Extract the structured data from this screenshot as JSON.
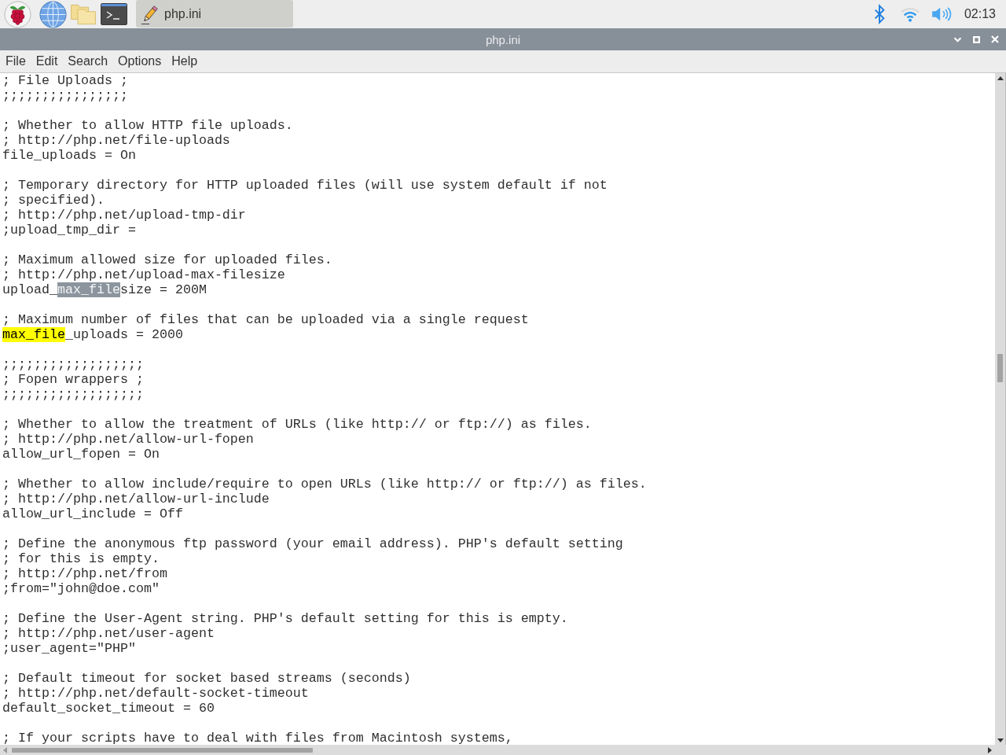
{
  "taskbar": {
    "tasks": [
      {
        "label": "php.ini",
        "selected": true
      }
    ],
    "clock": "02:13"
  },
  "window": {
    "title": "php.ini"
  },
  "menu": [
    "File",
    "Edit",
    "Search",
    "Options",
    "Help"
  ],
  "editor": {
    "blocks": [
      {
        "lines": [
          {
            "text": "; File Uploads ;"
          },
          {
            "text": ";;;;;;;;;;;;;;;;"
          }
        ]
      },
      {
        "lines": [
          {
            "text": "; Whether to allow HTTP file uploads."
          },
          {
            "text": "; http://php.net/file-uploads"
          },
          {
            "text": "file_uploads = On"
          }
        ]
      },
      {
        "lines": [
          {
            "text": "; Temporary directory for HTTP uploaded files (will use system default if not"
          },
          {
            "text": "; specified)."
          },
          {
            "text": "; http://php.net/upload-tmp-dir"
          },
          {
            "text": ";upload_tmp_dir ="
          }
        ]
      },
      {
        "lines": [
          {
            "text": "; Maximum allowed size for uploaded files."
          },
          {
            "text": "; http://php.net/upload-max-filesize"
          },
          {
            "parts": [
              {
                "text": "upload_",
                "kind": "plain"
              },
              {
                "text": "max_file",
                "kind": "selection"
              },
              {
                "text": "size = 200M",
                "kind": "plain"
              }
            ]
          }
        ]
      },
      {
        "lines": [
          {
            "text": "; Maximum number of files that can be uploaded via a single request"
          },
          {
            "parts": [
              {
                "text": "max_file",
                "kind": "match"
              },
              {
                "text": "_uploads = 2000",
                "kind": "plain"
              }
            ]
          }
        ]
      },
      {
        "lines": [
          {
            "text": ";;;;;;;;;;;;;;;;;;"
          },
          {
            "text": "; Fopen wrappers ;"
          },
          {
            "text": ";;;;;;;;;;;;;;;;;;"
          }
        ]
      },
      {
        "lines": [
          {
            "text": "; Whether to allow the treatment of URLs (like http:// or ftp://) as files."
          },
          {
            "text": "; http://php.net/allow-url-fopen"
          },
          {
            "text": "allow_url_fopen = On"
          }
        ]
      },
      {
        "lines": [
          {
            "text": "; Whether to allow include/require to open URLs (like http:// or ftp://) as files."
          },
          {
            "text": "; http://php.net/allow-url-include"
          },
          {
            "text": "allow_url_include = Off"
          }
        ]
      },
      {
        "lines": [
          {
            "text": "; Define the anonymous ftp password (your email address). PHP's default setting"
          },
          {
            "text": "; for this is empty."
          },
          {
            "text": "; http://php.net/from"
          },
          {
            "text": ";from=\"john@doe.com\""
          }
        ]
      },
      {
        "lines": [
          {
            "text": "; Define the User-Agent string. PHP's default setting for this is empty."
          },
          {
            "text": "; http://php.net/user-agent"
          },
          {
            "text": ";user_agent=\"PHP\""
          }
        ]
      },
      {
        "lines": [
          {
            "text": "; Default timeout for socket based streams (seconds)"
          },
          {
            "text": "; http://php.net/default-socket-timeout"
          },
          {
            "text": "default_socket_timeout = 60"
          }
        ]
      },
      {
        "lines": [
          {
            "text": "; If your scripts have to deal with files from Macintosh systems,"
          }
        ]
      }
    ]
  }
}
